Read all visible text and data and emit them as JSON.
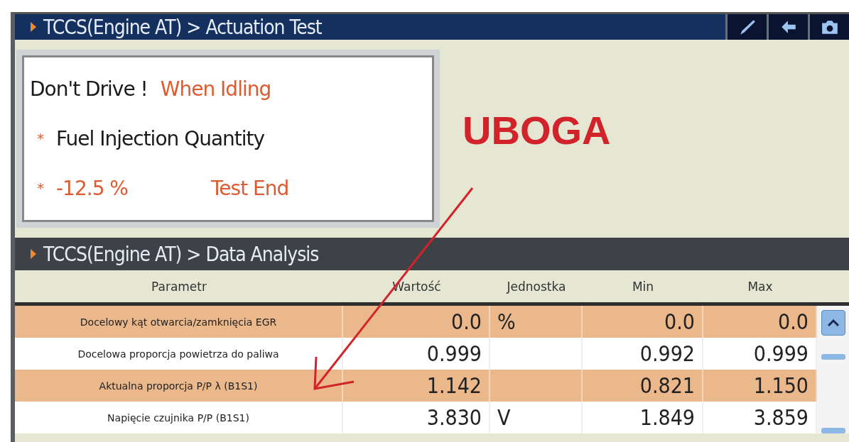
{
  "actuation": {
    "breadcrumb": "TCCS(Engine AT) > Actuation Test",
    "toolbar": [
      {
        "kind": "brush"
      },
      {
        "kind": "back"
      },
      {
        "kind": "camera"
      }
    ],
    "message": {
      "warning": "Don't Drive !",
      "condition": "When Idling",
      "item_marker": "*",
      "item": "Fuel Injection Quantity",
      "value_marker": "*",
      "value": "-12.5 %",
      "status": "Test End"
    }
  },
  "annotation": {
    "label": "UBOGA"
  },
  "analysis": {
    "breadcrumb": "TCCS(Engine AT) > Data Analysis",
    "table": {
      "columns": [
        "Parametr",
        "Wartość",
        "Jednostka",
        "Min",
        "Max"
      ],
      "rows": [
        {
          "cells": [
            "Docelowy kąt otwarcia/zamknięcia EGR",
            "0.0",
            "%",
            "0.0",
            "0.0"
          ],
          "highlighted": true
        },
        {
          "cells": [
            "Docelowa proporcja powietrza do paliwa",
            "0.999",
            "",
            "0.992",
            "0.999"
          ],
          "highlighted": false
        },
        {
          "cells": [
            "Aktualna proporcja P/P λ (B1S1)",
            "1.142",
            "",
            "0.821",
            "1.150"
          ],
          "highlighted": true
        },
        {
          "cells": [
            "Napięcie czujnika P/P (B1S1)",
            "3.830",
            "V",
            "1.849",
            "3.859"
          ],
          "highlighted": false
        }
      ]
    }
  }
}
